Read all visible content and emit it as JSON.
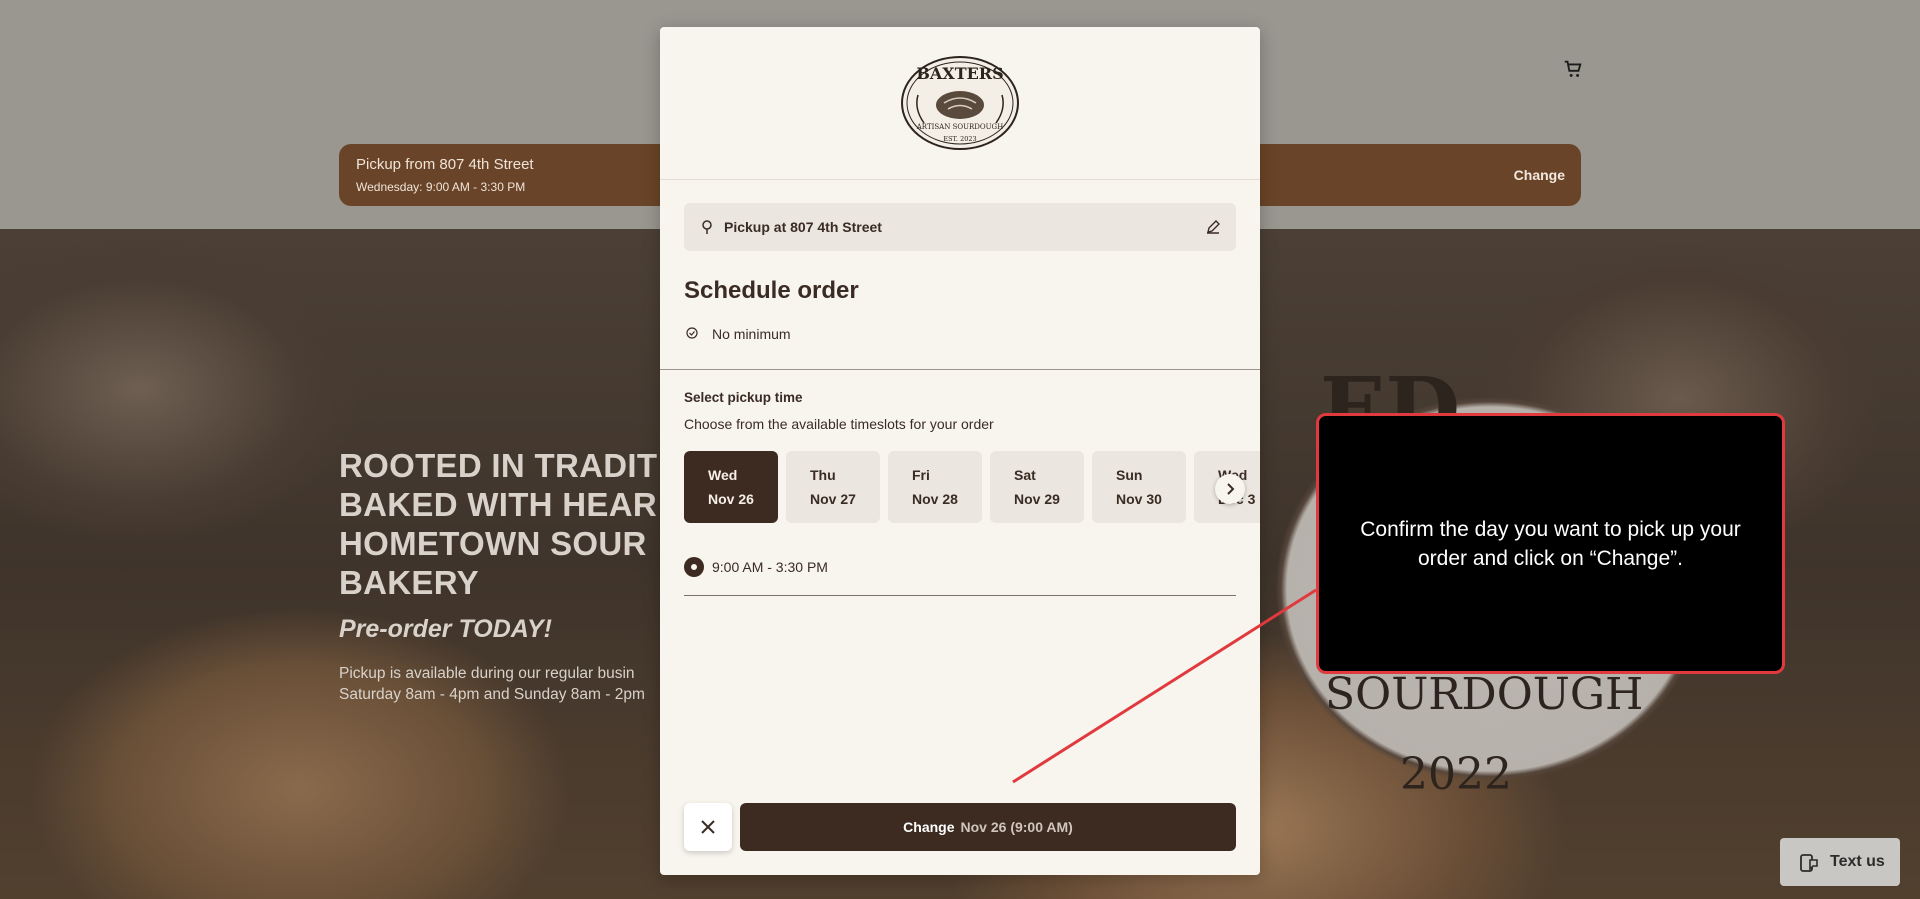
{
  "banner": {
    "line1": "Pickup from 807 4th Street",
    "line2": "Wednesday: 9:00 AM - 3:30 PM",
    "change": "Change"
  },
  "hero": {
    "title_lines": [
      "ROOTED IN TRADIT",
      "BAKED WITH HEAR",
      "HOMETOWN SOUR",
      "BAKERY"
    ],
    "subtitle": "Pre-order TODAY!",
    "body_lines": [
      "Pickup is available during our regular busin",
      "Saturday 8am - 4pm and Sunday 8am - 2pm"
    ],
    "badge_text_top": "ED",
    "badge_text_mid": "SOURDOUGH",
    "badge_text_year": "2022"
  },
  "modal": {
    "logo": {
      "name": "BAXTERS",
      "tagline": "ARTISAN SOURDOUGH",
      "est": "EST. 2023"
    },
    "pickup_label": "Pickup at 807 4th Street",
    "title": "Schedule order",
    "minimum": "No minimum",
    "select_title": "Select pickup time",
    "select_sub": "Choose from the available timeslots for your order",
    "days": [
      {
        "dow": "Wed",
        "date": "Nov 26",
        "selected": true
      },
      {
        "dow": "Thu",
        "date": "Nov 27",
        "selected": false
      },
      {
        "dow": "Fri",
        "date": "Nov 28",
        "selected": false
      },
      {
        "dow": "Sat",
        "date": "Nov 29",
        "selected": false
      },
      {
        "dow": "Sun",
        "date": "Nov 30",
        "selected": false
      },
      {
        "dow": "Wed",
        "date": "Dec 3",
        "selected": false
      }
    ],
    "timeslot": "9:00 AM - 3:30 PM",
    "change_button": {
      "label": "Change",
      "when": "Nov 26 (9:00 AM)"
    }
  },
  "callout": {
    "text": "Confirm the day you want to pick up your order and click on “Change”."
  },
  "textus": {
    "label": "Text us"
  },
  "colors": {
    "accent": "#3d2b22",
    "banner": "#6a4428",
    "callout_border": "#e03a3e"
  }
}
